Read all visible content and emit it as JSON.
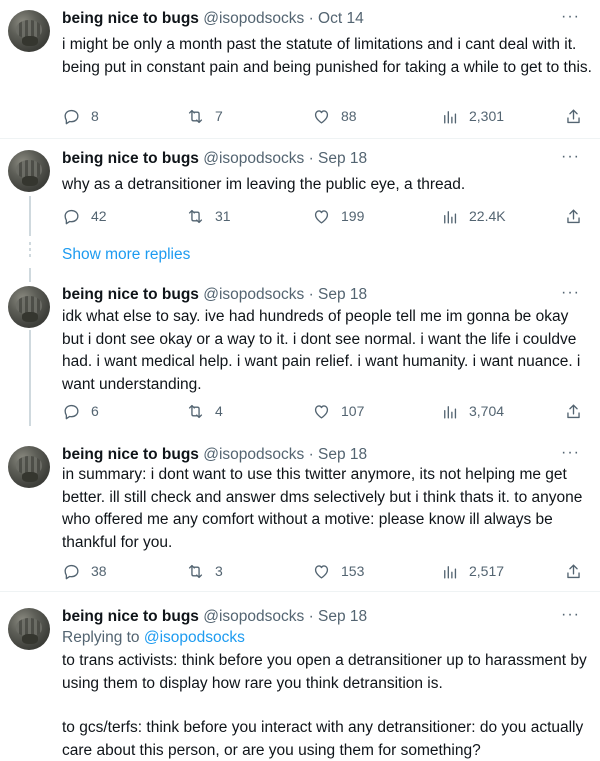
{
  "tweets": [
    {
      "name": "being nice to bugs",
      "meta": "@isopodsocks · Oct 14",
      "text": "i might be only a month past the statute of limitations and i cant deal with it. being put in constant pain and being punished for taking a while to get to this.",
      "replies": "8",
      "retweets": "7",
      "likes": "88",
      "views": "2,301"
    },
    {
      "name": "being nice to bugs",
      "meta": "@isopodsocks · Sep 18",
      "text": "why as a detransitioner im leaving the public eye, a thread.",
      "replies": "42",
      "retweets": "31",
      "likes": "199",
      "views": "22.4K"
    },
    {
      "name": "being nice to bugs",
      "meta": "@isopodsocks · Sep 18",
      "text": "idk what else to say. ive had hundreds of people tell me im gonna be okay but i dont see okay or a way to it. i dont see normal. i want the life i couldve had. i want medical help. i want pain relief. i want humanity. i want nuance. i want understanding.",
      "replies": "6",
      "retweets": "4",
      "likes": "107",
      "views": "3,704"
    },
    {
      "name": "being nice to bugs",
      "meta": "@isopodsocks · Sep 18",
      "text": "in summary: i dont want to use this twitter anymore, its not helping me get better. ill still check and answer dms selectively but i think thats it. to anyone who offered me any comfort without a motive: please know ill always be thankful for you.",
      "replies": "38",
      "retweets": "3",
      "likes": "153",
      "views": "2,517"
    },
    {
      "name": "being nice to bugs",
      "meta": "@isopodsocks · Sep 18",
      "replying_label": "Replying to ",
      "replying_handle": "@isopodsocks",
      "text_p1": "to trans activists: think before you open a detransitioner up to harassment by using them to display how rare you think detransition is.",
      "text_p2": "to gcs/terfs: think before you interact with any detransitioner: do you actually care about this person, or are you using them for something?"
    }
  ],
  "show_more_replies": "Show more replies",
  "more_glyph": "···",
  "icons": [
    "reply-icon",
    "retweet-icon",
    "like-icon",
    "views-icon",
    "share-icon",
    "more-icon"
  ]
}
